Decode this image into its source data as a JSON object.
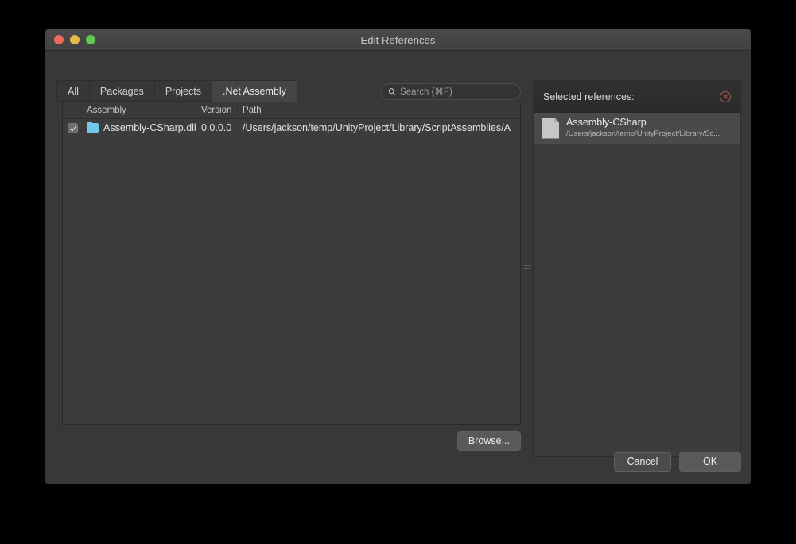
{
  "window": {
    "title": "Edit References",
    "traffic_lights": [
      {
        "name": "close",
        "color": "#ed6a5e"
      },
      {
        "name": "minimize",
        "color": "#e4b84d"
      },
      {
        "name": "zoom",
        "color": "#62c554"
      }
    ]
  },
  "tabs": [
    {
      "label": "All",
      "active": false
    },
    {
      "label": "Packages",
      "active": false
    },
    {
      "label": "Projects",
      "active": false
    },
    {
      "label": ".Net Assembly",
      "active": true
    }
  ],
  "search": {
    "placeholder": "Search (⌘F)",
    "value": "",
    "icon": "search-icon"
  },
  "table": {
    "columns": [
      "",
      "Assembly",
      "Version",
      "Path"
    ],
    "rows": [
      {
        "checked": true,
        "icon": "folder-icon",
        "assembly": "Assembly-CSharp.dll",
        "version": "0.0.0.0",
        "path": "/Users/jackson/temp/UnityProject/Library/ScriptAssemblies/A"
      }
    ]
  },
  "browse_button": {
    "label": "Browse..."
  },
  "selected_panel": {
    "title": "Selected references:",
    "remove_icon": "remove-circle-icon",
    "items": [
      {
        "icon": "file-icon",
        "name": "Assembly-CSharp",
        "path": "/Users/jackson/temp/UnityProject/Library/Sc..."
      }
    ]
  },
  "footer": {
    "cancel_label": "Cancel",
    "ok_label": "OK"
  }
}
